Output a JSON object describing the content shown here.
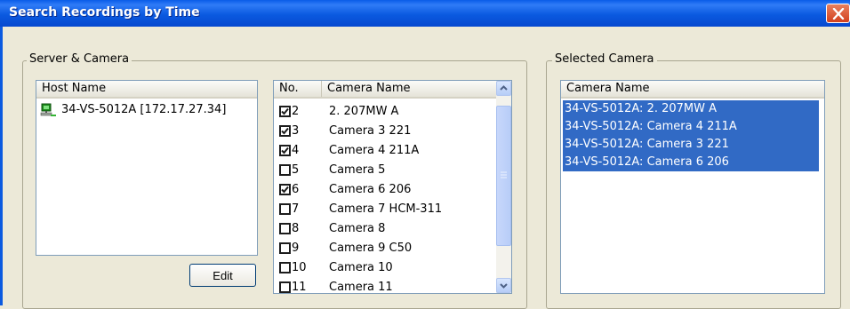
{
  "window": {
    "title": "Search Recordings by Time",
    "close_icon": "close-icon"
  },
  "server_camera": {
    "group_label": "Server & Camera",
    "host_list": {
      "header": "Host Name",
      "hosts": [
        {
          "name": "34-VS-5012A [172.17.27.34]",
          "icon": "server-computer-icon"
        }
      ]
    },
    "edit_button": "Edit",
    "camera_list": {
      "headers": {
        "no": "No.",
        "name": "Camera Name"
      },
      "cameras": [
        {
          "no": "2",
          "name": "2. 207MW A",
          "checked": true
        },
        {
          "no": "3",
          "name": "Camera 3 221",
          "checked": true
        },
        {
          "no": "4",
          "name": "Camera 4 211A",
          "checked": true
        },
        {
          "no": "5",
          "name": "Camera 5",
          "checked": false
        },
        {
          "no": "6",
          "name": "Camera 6 206",
          "checked": true
        },
        {
          "no": "7",
          "name": "Camera 7 HCM-311",
          "checked": false
        },
        {
          "no": "8",
          "name": "Camera 8",
          "checked": false
        },
        {
          "no": "9",
          "name": "Camera 9 C50",
          "checked": false
        },
        {
          "no": "10",
          "name": "Camera 10",
          "checked": false
        },
        {
          "no": "11",
          "name": "Camera 11",
          "checked": false
        }
      ]
    }
  },
  "selected_camera": {
    "group_label": "Selected Camera",
    "header": "Camera Name",
    "items": [
      "34-VS-5012A: 2. 207MW A",
      "34-VS-5012A: Camera 4 211A",
      "34-VS-5012A: Camera 3 221",
      "34-VS-5012A: Camera 6 206"
    ]
  },
  "colors": {
    "titlebar": "#0b5ae0",
    "selection": "#316ac5",
    "dialog_bg": "#ece9d8"
  }
}
